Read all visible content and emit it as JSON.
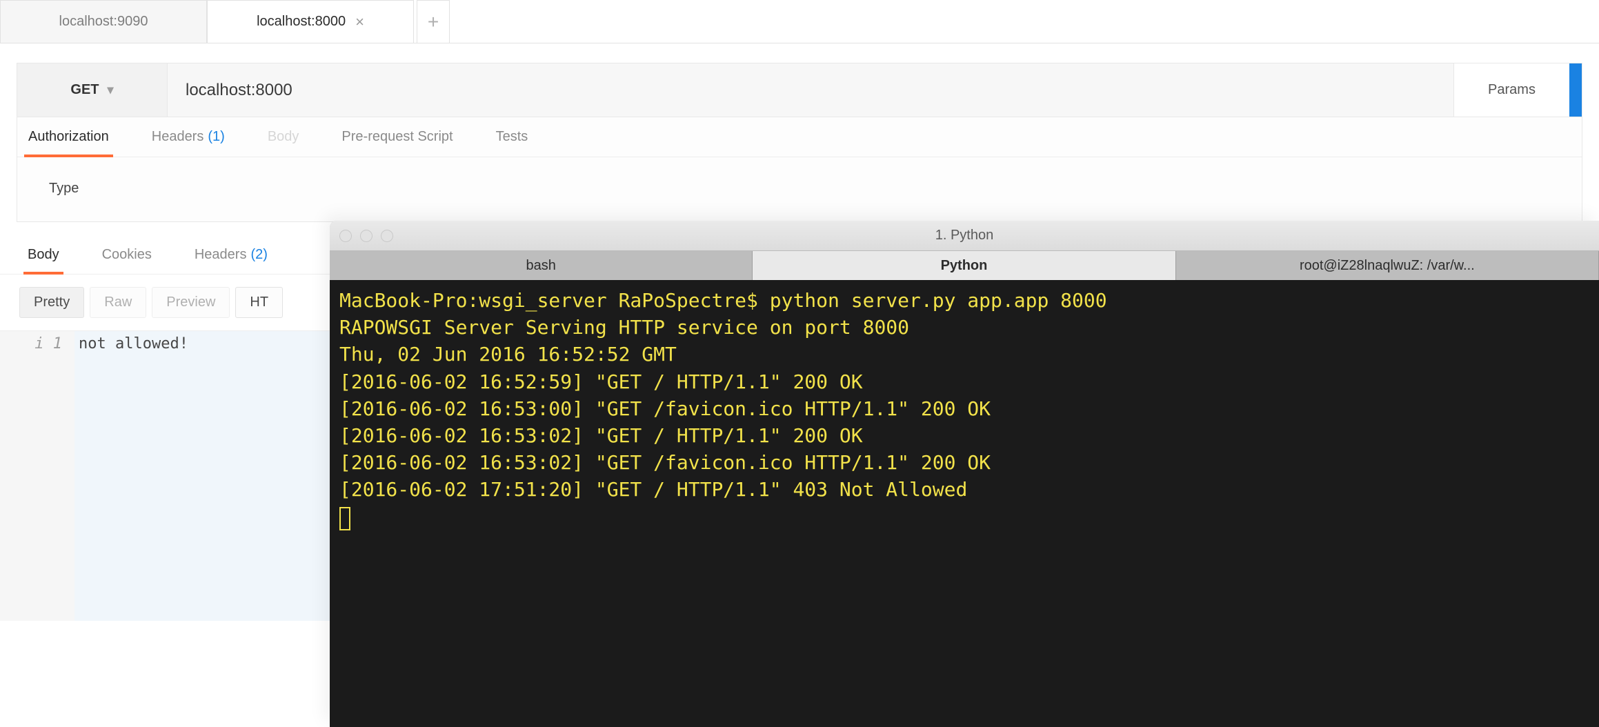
{
  "browserTabs": {
    "items": [
      {
        "label": "localhost:9090",
        "active": false
      },
      {
        "label": "localhost:8000",
        "active": true
      }
    ]
  },
  "request": {
    "method": "GET",
    "url": "localhost:8000",
    "paramsLabel": "Params",
    "tabs": {
      "authorization": "Authorization",
      "headers": "Headers",
      "headersCount": "(1)",
      "body": "Body",
      "prerequest": "Pre-request Script",
      "tests": "Tests"
    },
    "typeLabel": "Type"
  },
  "response": {
    "tabs": {
      "body": "Body",
      "cookies": "Cookies",
      "headers": "Headers",
      "headersCount": "(2)"
    },
    "viewButtons": {
      "pretty": "Pretty",
      "raw": "Raw",
      "preview": "Preview",
      "html": "HT"
    },
    "gutterPrefix": "i",
    "lineNumber": "1",
    "bodyText": "not allowed!"
  },
  "terminal": {
    "title": "1. Python",
    "tabs": [
      {
        "label": "bash",
        "active": false
      },
      {
        "label": "Python",
        "active": true
      },
      {
        "label": "root@iZ28lnaqlwuZ: /var/w...",
        "active": false
      }
    ],
    "lines": [
      "MacBook-Pro:wsgi_server RaPoSpectre$ python server.py app.app 8000",
      "RAPOWSGI Server Serving HTTP service on port 8000",
      "Thu, 02 Jun 2016 16:52:52 GMT",
      "[2016-06-02 16:52:59] \"GET / HTTP/1.1\" 200 OK",
      "[2016-06-02 16:53:00] \"GET /favicon.ico HTTP/1.1\" 200 OK",
      "[2016-06-02 16:53:02] \"GET / HTTP/1.1\" 200 OK",
      "[2016-06-02 16:53:02] \"GET /favicon.ico HTTP/1.1\" 200 OK",
      "[2016-06-02 17:51:20] \"GET / HTTP/1.1\" 403 Not Allowed"
    ]
  }
}
